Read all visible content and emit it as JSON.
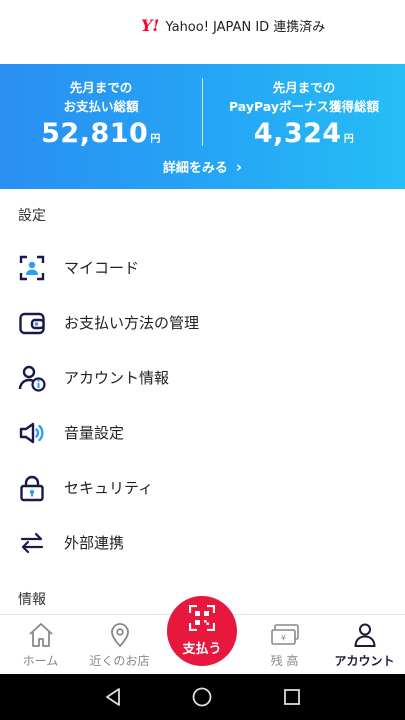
{
  "header": {
    "yahoo_logo_text": "Y!",
    "yahoo_link_label": "Yahoo! JAPAN ID 連携済み"
  },
  "summary": {
    "left_label_line1": "先月までの",
    "left_label_line2": "お支払い総額",
    "left_value": "52,810",
    "left_unit": "円",
    "right_label_line1": "先月までの",
    "right_label_line2": "PayPayボーナス獲得総額",
    "right_value": "4,324",
    "right_unit": "円",
    "detail_link": "詳細をみる",
    "detail_chevron": "›"
  },
  "sections": {
    "settings_title": "設定",
    "info_title": "情報"
  },
  "menu": {
    "items": [
      {
        "label": "マイコード",
        "icon": "qr-user-icon"
      },
      {
        "label": "お支払い方法の管理",
        "icon": "wallet-icon"
      },
      {
        "label": "アカウント情報",
        "icon": "user-info-icon"
      },
      {
        "label": "音量設定",
        "icon": "speaker-icon"
      },
      {
        "label": "セキュリティ",
        "icon": "lock-icon"
      },
      {
        "label": "外部連携",
        "icon": "swap-arrows-icon"
      }
    ]
  },
  "tabbar": {
    "home": "ホーム",
    "nearby": "近くのお店",
    "pay": "支払う",
    "balance": "残 高",
    "account": "アカウント",
    "active_tab": "account"
  },
  "colors": {
    "brand_blue_start": "#2a8ff2",
    "brand_blue_end": "#26bdf6",
    "pay_red": "#e8173d",
    "icon_navy": "#1a1a4a",
    "icon_accent": "#2aa0f0"
  }
}
